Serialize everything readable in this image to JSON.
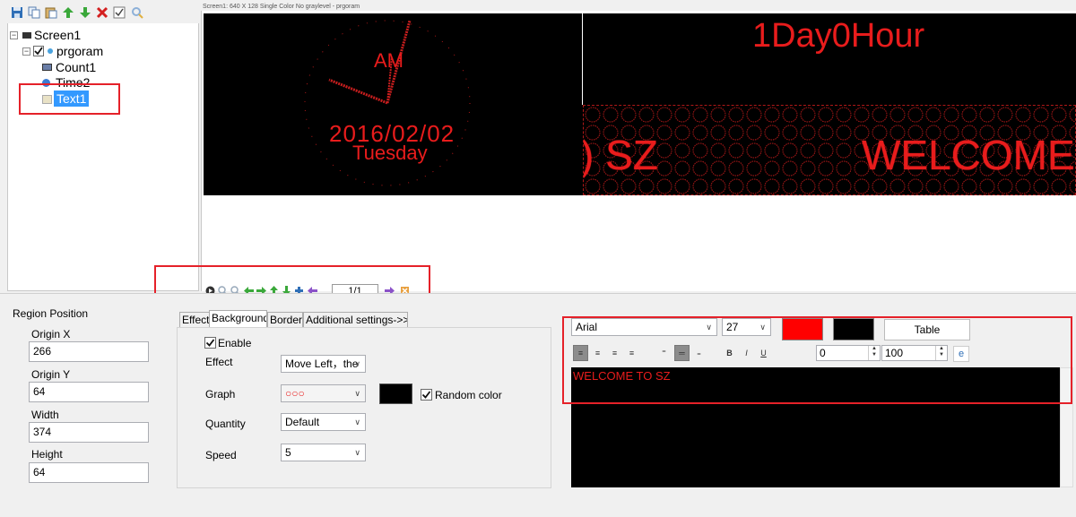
{
  "toolbar": {
    "icons": [
      "save-icon",
      "copy-icon",
      "paste-icon",
      "move-up-icon",
      "move-down-icon",
      "delete-icon",
      "checkbox-icon",
      "settings-icon"
    ]
  },
  "tree": {
    "root_label": "Screen1",
    "program_label": "prgoram",
    "items": [
      {
        "label": "Count1"
      },
      {
        "label": "Time2"
      },
      {
        "label": "Text1"
      }
    ]
  },
  "preview": {
    "title": "Screen1: 640 X 128  Single Color No graylevel - prgoram",
    "clock": {
      "am_pm": "AM",
      "date": "2016/02/02",
      "weekday": "Tuesday"
    },
    "counter_text": "1Day0Hour",
    "scroll_text_left": ") SZ",
    "scroll_text_right": "WELCOME"
  },
  "navbar": {
    "page_indicator": "1/1"
  },
  "region": {
    "heading": "Region Position",
    "origin_x_label": "Origin X",
    "origin_x": "266",
    "origin_y_label": "Origin Y",
    "origin_y": "64",
    "width_label": "Width",
    "width": "374",
    "height_label": "Height",
    "height": "64"
  },
  "tabs": [
    {
      "label": "Effect",
      "active": false
    },
    {
      "label": "Background",
      "active": true
    },
    {
      "label": "Border",
      "active": false
    },
    {
      "label": "Additional settings->>",
      "active": false
    }
  ],
  "background": {
    "enable_label": "Enable",
    "enable_checked": true,
    "effect_label": "Effect",
    "effect_value": "Move Left，the",
    "graph_label": "Graph",
    "graph_value": "○○○",
    "random_color_label": "Random color",
    "random_color_checked": true,
    "quantity_label": "Quantity",
    "quantity_value": "Default",
    "speed_label": "Speed",
    "speed_value": "5"
  },
  "text_editor": {
    "font": "Arial",
    "font_size": "27",
    "foreground_color": "#ff0000",
    "background_color": "#000000",
    "table_button": "Table",
    "spacing_value": "0",
    "scale_value": "100",
    "content": "WELCOME TO SZ",
    "text_color": "#e81c1c"
  }
}
